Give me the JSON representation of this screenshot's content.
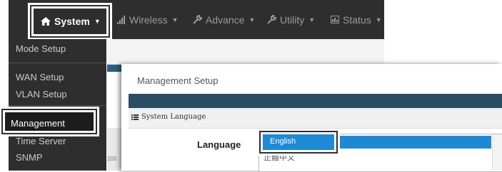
{
  "navbar": {
    "system": "System",
    "wireless": "Wireless",
    "advance": "Advance",
    "utility": "Utility",
    "status": "Status"
  },
  "dropdown": {
    "items": [
      "Mode Setup",
      "WAN Setup",
      "VLAN Setup",
      "Management",
      "Time Server",
      "SNMP"
    ]
  },
  "background": {
    "gauge_tick": "100"
  },
  "panel": {
    "title": "Management Setup",
    "section_title": "System Language",
    "language_label": "Language",
    "language_options": [
      "English",
      "正體中文"
    ],
    "selected_language": "English"
  },
  "colors": {
    "navbar": "#2e2e2e",
    "selection": "#1e8ad6",
    "panel_bar": "#294d63"
  }
}
